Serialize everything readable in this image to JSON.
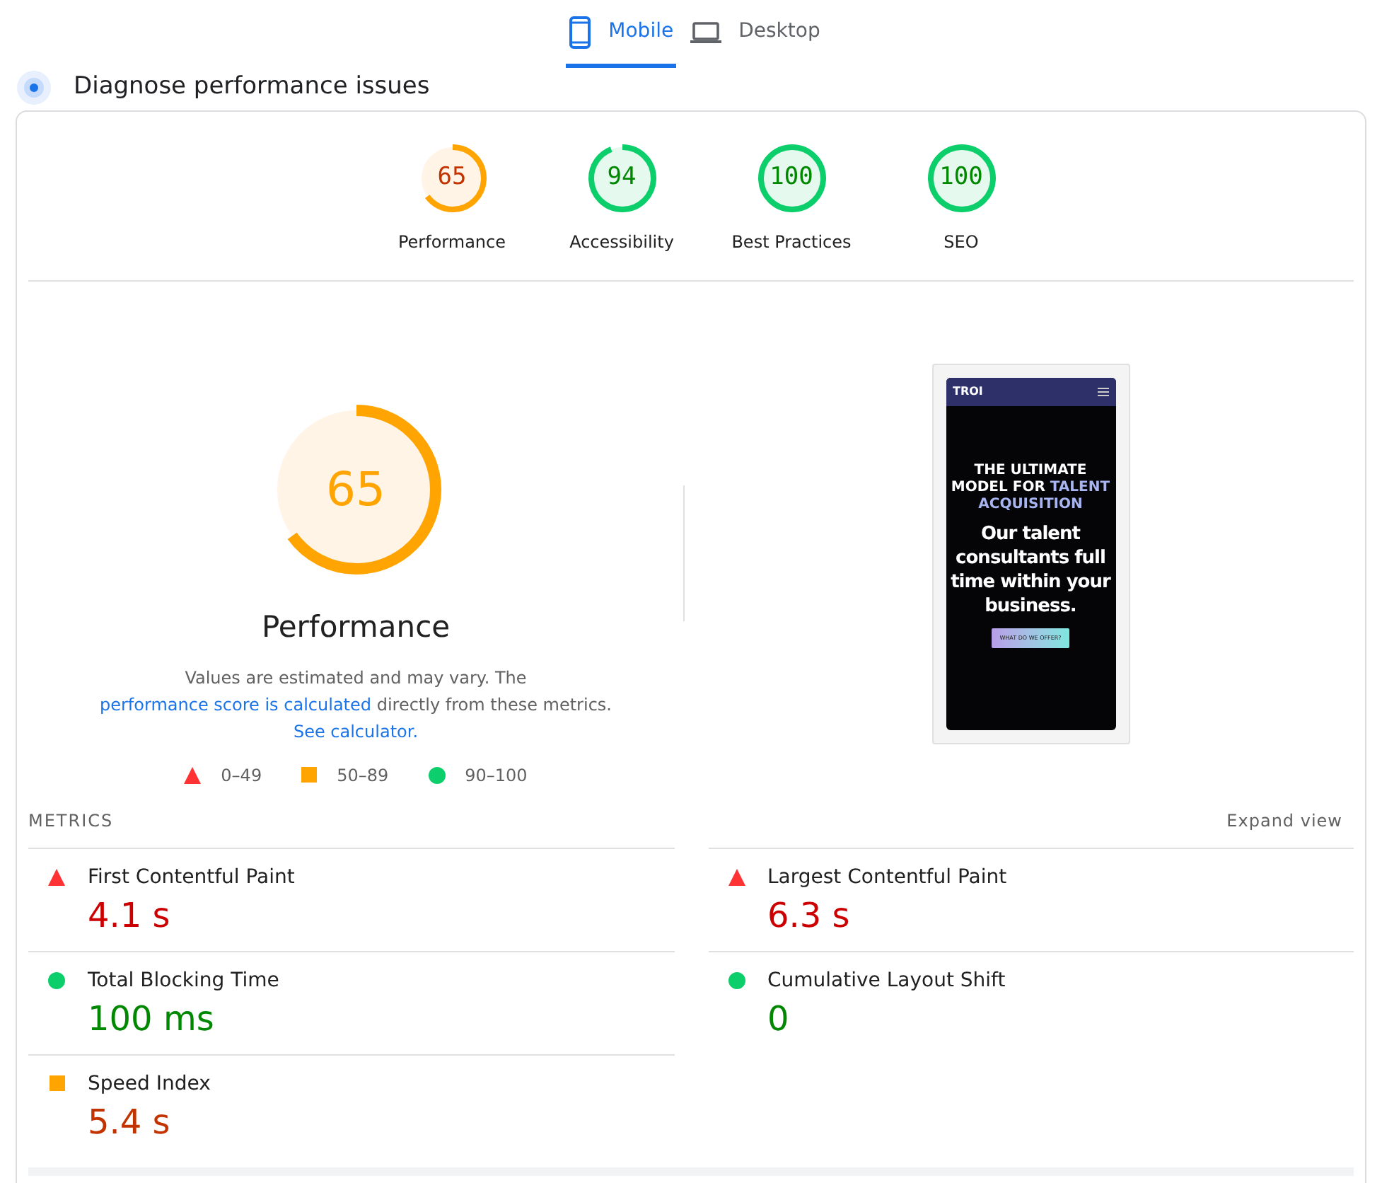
{
  "tabs": [
    {
      "label": "Mobile",
      "selected": true
    },
    {
      "label": "Desktop",
      "selected": false
    }
  ],
  "heading": "Diagnose performance issues",
  "gauges": [
    {
      "score": "65",
      "label": "Performance",
      "kind": "average",
      "level": 0.65
    },
    {
      "score": "94",
      "label": "Accessibility",
      "kind": "pass",
      "level": 0.94
    },
    {
      "score": "100",
      "label": "Best Practices",
      "kind": "pass",
      "level": 1
    },
    {
      "score": "100",
      "label": "SEO",
      "kind": "pass",
      "level": 1
    }
  ],
  "main_gauge": {
    "score": "65",
    "label": "Performance",
    "kind": "average",
    "level": 0.65
  },
  "description": [
    {
      "kind": "text",
      "text": "Values are estimated and may vary. The "
    },
    {
      "kind": "link",
      "text": "performance score is calculated"
    },
    {
      "kind": "text",
      "text": " directly from these metrics. "
    },
    {
      "kind": "link",
      "text": "See calculator."
    }
  ],
  "legend": [
    {
      "kind": "fail",
      "text": "0–49"
    },
    {
      "kind": "average",
      "text": "50–89"
    },
    {
      "kind": "pass",
      "text": "90–100"
    }
  ],
  "screenshot": {
    "brand": "TROI",
    "headline": "THE ULTIMATE MODEL FOR",
    "highlight": "TALENT ACQUISITION",
    "subhead": "Our talent consultants full time within your business.",
    "button": "WHAT DO WE OFFER?"
  },
  "metrics_title": "METRICS",
  "expand": "Expand view",
  "metrics": [
    {
      "name": "First Contentful Paint",
      "value": "4.1 s",
      "kind": "fail"
    },
    {
      "name": "Largest Contentful Paint",
      "value": "6.3 s",
      "kind": "fail"
    },
    {
      "name": "Total Blocking Time",
      "value": "100 ms",
      "kind": "pass"
    },
    {
      "name": "Cumulative Layout Shift",
      "value": "0",
      "kind": "pass"
    },
    {
      "name": "Speed Index",
      "value": "5.4 s",
      "kind": "average"
    }
  ]
}
